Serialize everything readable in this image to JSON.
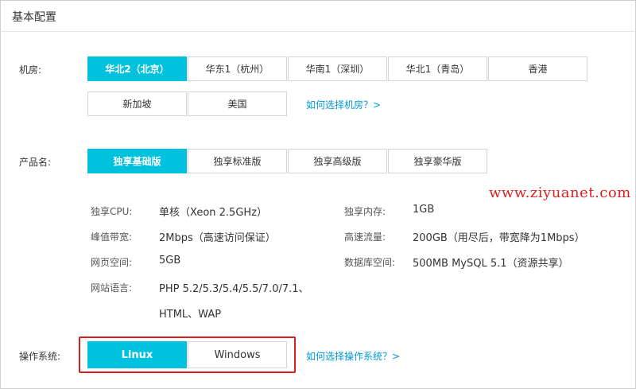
{
  "header": {
    "title": "基本配置"
  },
  "datacenter": {
    "label": "机房:",
    "options": [
      "华北2（北京）",
      "华东1（杭州）",
      "华南1（深圳）",
      "华北1（青岛）",
      "香港",
      "新加坡",
      "美国"
    ],
    "selected": "华北2（北京）",
    "help_link": "如何选择机房？>"
  },
  "product": {
    "label": "产品名:",
    "options": [
      "独享基础版",
      "独享标准版",
      "独享高级版",
      "独享豪华版"
    ],
    "selected": "独享基础版"
  },
  "specs": {
    "cpu_label": "独享CPU:",
    "cpu_value": "单核（Xeon 2.5GHz）",
    "memory_label": "独享内存:",
    "memory_value": "1GB",
    "bandwidth_label": "峰值带宽:",
    "bandwidth_value": "2Mbps（高速访问保证）",
    "traffic_label": "高速流量:",
    "traffic_value": "200GB（用尽后，带宽降为1Mbps）",
    "space_label": "网页空间:",
    "space_value": "5GB",
    "db_label": "数据库空间:",
    "db_value": "500MB MySQL 5.1（资源共享）",
    "lang_label": "网站语言:",
    "lang_value_line1": "PHP 5.2/5.3/5.4/5.5/7.0/7.1、",
    "lang_value_line2": "HTML、WAP"
  },
  "os": {
    "label": "操作系统:",
    "options": [
      "Linux",
      "Windows"
    ],
    "selected": "Linux",
    "help_link": "如何选择操作系统？>"
  },
  "watermark": "www.ziyuanet.com",
  "colors": {
    "accent": "#00c1de",
    "link": "#0099d6",
    "highlight_box": "#d61f1f",
    "watermark": "#e02020"
  }
}
